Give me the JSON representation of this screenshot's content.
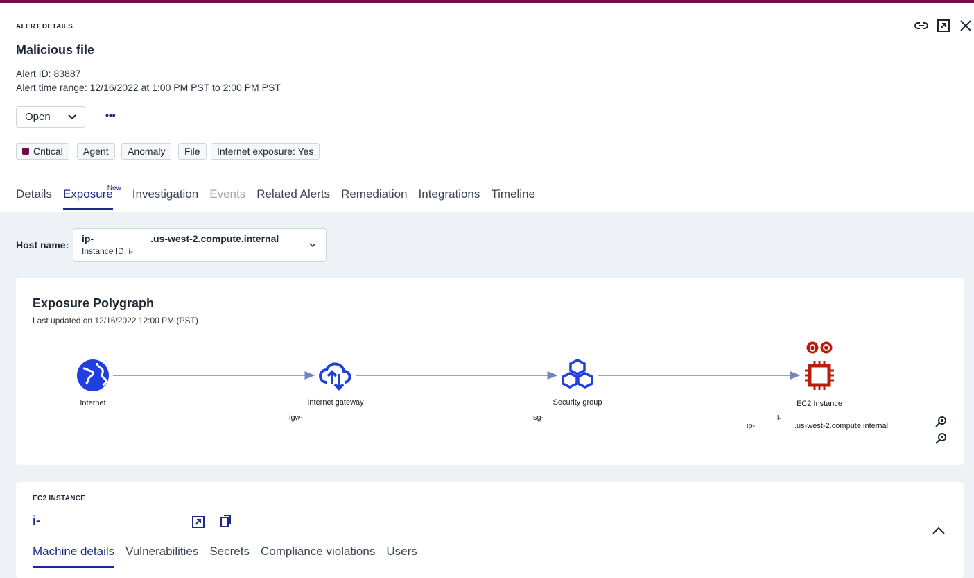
{
  "header": {
    "eyebrow": "ALERT DETAILS",
    "title": "Malicious file",
    "alert_id": "Alert ID: 83887",
    "time_range": "Alert time range: 12/16/2022 at 1:00 PM PST to 2:00 PM PST"
  },
  "status": {
    "value": "Open",
    "more": "•••"
  },
  "tags": [
    "Critical",
    "Agent",
    "Anomaly",
    "File",
    "Internet exposure: Yes"
  ],
  "colors": {
    "critical": "#6b0f4f",
    "accent": "#1b2a8a",
    "node": "#1f3fe0",
    "ec2": "#b81c0a"
  },
  "tabs": [
    {
      "label": "Details"
    },
    {
      "label": "Exposure",
      "badge": "New"
    },
    {
      "label": "Investigation"
    },
    {
      "label": "Events"
    },
    {
      "label": "Related Alerts"
    },
    {
      "label": "Remediation"
    },
    {
      "label": "Integrations"
    },
    {
      "label": "Timeline"
    }
  ],
  "host": {
    "label": "Host name:",
    "name_prefix": "ip-",
    "name_suffix": ".us-west-2.compute.internal",
    "instance": "Instance ID: i-"
  },
  "polygraph": {
    "title": "Exposure Polygraph",
    "updated": "Last updated on 12/16/2022 12:00 PM (PST)",
    "nodes": [
      {
        "label": "Internet"
      },
      {
        "label": "Internet gateway",
        "sub": "igw-"
      },
      {
        "label": "Security group",
        "sub": "sg-"
      },
      {
        "label": "EC2 Instance",
        "sub_id": "i-",
        "sub_ip": "ip-",
        "sub_host": ".us-west-2.compute.internal"
      }
    ]
  },
  "ec2": {
    "eyebrow": "EC2 INSTANCE",
    "id": "i-",
    "tabs": [
      "Machine details",
      "Vulnerabilities",
      "Secrets",
      "Compliance violations",
      "Users"
    ]
  }
}
